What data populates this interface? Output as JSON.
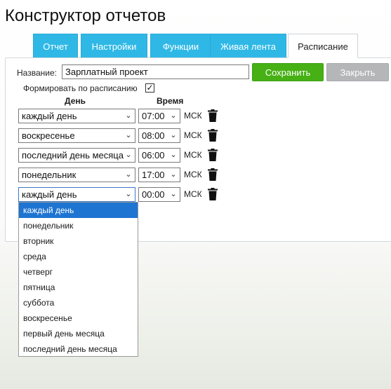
{
  "page": {
    "title": "Конструктор отчетов"
  },
  "tabs": [
    {
      "label": "Отчет",
      "active": false
    },
    {
      "label": "Настройки",
      "active": false
    },
    {
      "label": "Функции",
      "active": false
    },
    {
      "label": "Живая лента",
      "active": false
    },
    {
      "label": "Расписание",
      "active": true
    }
  ],
  "form": {
    "name_label": "Название:",
    "name_value": "Зарплатный проект",
    "save_label": "Сохранить",
    "close_label": "Закрыть",
    "schedule_checkbox_label": "Формировать по расписанию",
    "schedule_checked": true,
    "schedule_check_glyph": "✓"
  },
  "schedule": {
    "day_header": "День",
    "time_header": "Время",
    "timezone": "МСК",
    "rows": [
      {
        "day": "каждый день",
        "time": "07:00"
      },
      {
        "day": "воскресенье",
        "time": "08:00"
      },
      {
        "day": "последний день месяца",
        "time": "06:00"
      },
      {
        "day": "понедельник",
        "time": "17:00"
      },
      {
        "day": "каждый день",
        "time": "00:00"
      }
    ]
  },
  "dropdown": {
    "open": true,
    "selected_index": 0,
    "options": [
      "каждый день",
      "понедельник",
      "вторник",
      "среда",
      "четверг",
      "пятница",
      "суббота",
      "воскресенье",
      "первый день месяца",
      "последний день месяца"
    ]
  },
  "icons": {
    "trash": "trash-icon",
    "chevron": "chevron-down-icon",
    "checkbox": "checkmark-icon"
  },
  "colors": {
    "tab_blue": "#2fb8e6",
    "save_green": "#46b015",
    "close_gray": "#b4b6b8",
    "selection_blue": "#1e74d1"
  }
}
